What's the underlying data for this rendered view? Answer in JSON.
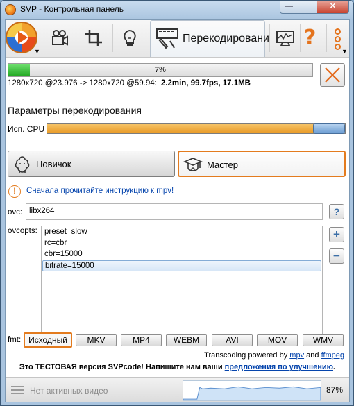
{
  "window": {
    "title": "SVP - Контрольная панель",
    "buttons": [
      "0",
      "1",
      "r"
    ]
  },
  "toolbar": {
    "active_tab_label": "Перекодировани",
    "icons": [
      "svp-logo-icon",
      "movie-camera-icon",
      "crop-icon",
      "lightbulb-icon",
      "transcode-icon",
      "monitor-icon",
      "question-icon",
      "more-icon"
    ]
  },
  "progress": {
    "percent": 7,
    "label": "7%",
    "source": "1280x720 @23.976 -> 1280x720 @59.94:",
    "stats": "2.2min, 99.7fps, 17.1MB"
  },
  "transcode": {
    "section_title": "Параметры перекодирования",
    "cpu_label": "Исп. CPU",
    "cpu_fraction": 0.9,
    "mode_novice": "Новичок",
    "mode_master": "Мастер",
    "warning_link": "Сначала прочитайте инструкцию к mpv!",
    "ovc_label": "ovc:",
    "ovc_value": "libx264",
    "help_button": "?",
    "ovcopts_label": "ovcopts:",
    "ovcopts": [
      "preset=slow",
      "rc=cbr",
      "cbr=15000",
      "bitrate=15000"
    ],
    "selected_opt": "bitrate=15000",
    "add_button": "+",
    "remove_button": "−",
    "fmt_label": "fmt:",
    "formats": [
      "Исходный",
      "MKV",
      "MP4",
      "WEBM",
      "AVI",
      "MOV",
      "WMV"
    ],
    "selected_format": "Исходный"
  },
  "footer": {
    "powered_prefix": "Transcoding powered by",
    "mpv_link": "mpv",
    "and": "and",
    "ffmpeg_link": "ffmpeg",
    "test_text": "Это ТЕСТОВАЯ версия SVPcode! Напишите нам ваши",
    "test_link": "предложения по улучшению",
    "test_end": "."
  },
  "statusbar": {
    "no_video": "Нет активных видео",
    "cpu_percent": "87%"
  },
  "colors": {
    "accent": "#e37b1e",
    "progress_green": "#22a722",
    "link": "#0645ad"
  }
}
